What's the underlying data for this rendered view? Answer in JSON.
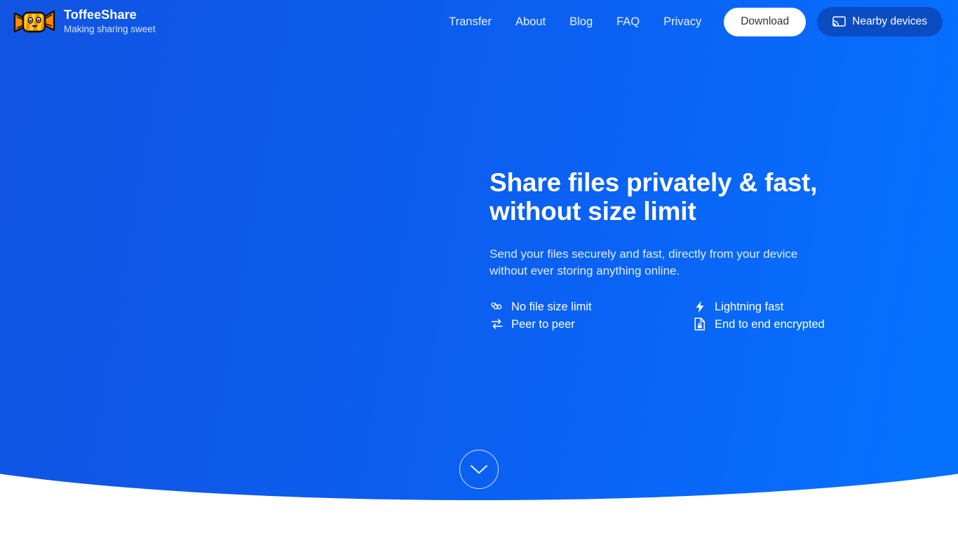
{
  "brand": {
    "name": "ToffeeShare",
    "tagline": "Making sharing sweet",
    "logo_icon": "toffee-candy-icon"
  },
  "nav": {
    "items": [
      {
        "label": "Transfer"
      },
      {
        "label": "About"
      },
      {
        "label": "Blog"
      },
      {
        "label": "FAQ"
      },
      {
        "label": "Privacy"
      }
    ]
  },
  "header_actions": {
    "download_label": "Download",
    "nearby_label": "Nearby devices",
    "nearby_icon": "cast-icon"
  },
  "hero": {
    "title": "Share files privately & fast, without size limit",
    "subtitle": "Send your files securely and fast, directly from your device without ever storing anything online.",
    "features": [
      {
        "label": "No file size limit",
        "icon": "infinity-icon"
      },
      {
        "label": "Lightning fast",
        "icon": "lightning-bolt-icon"
      },
      {
        "label": "Peer to peer",
        "icon": "swap-arrows-icon"
      },
      {
        "label": "End to end encrypted",
        "icon": "document-lock-icon"
      }
    ],
    "scroll_down_icon": "chevron-down-icon"
  },
  "colors": {
    "hero_gradient_start": "#1253dd",
    "hero_gradient_end": "#0670ff",
    "nearby_button_bg": "#0c4cc2",
    "download_button_bg": "#ffffff",
    "download_button_text": "#333333",
    "page_bg": "#ffffff"
  }
}
